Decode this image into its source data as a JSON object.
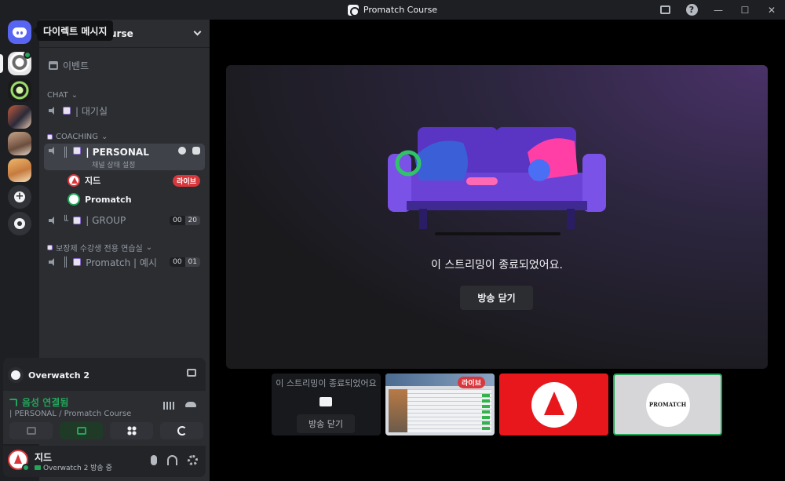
{
  "titlebar": {
    "title": "Promatch Course"
  },
  "tooltip": {
    "text": "다이렉트 메시지"
  },
  "guild": {
    "name_visible": "urse"
  },
  "sidebar": {
    "events_label": "이벤트",
    "chat_category": "CHAT",
    "waiting_room": "| 대기실",
    "coaching_category": "COACHING",
    "personal_channel": "| PERSONAL",
    "channel_status_hint": "채널 상태 설정",
    "members": [
      {
        "name": "지드",
        "badge": "라이브"
      },
      {
        "name": "Promatch"
      }
    ],
    "group_channel": "| GROUP",
    "group_counts": [
      "00",
      "20"
    ],
    "practice_category": "보장제 수강생 전용 연습실",
    "example_channel": "Promatch | 예시",
    "example_counts": [
      "00",
      "01"
    ]
  },
  "activity": {
    "game": "Overwatch 2"
  },
  "voice": {
    "status": "음성 연결됨",
    "location": "| PERSONAL / Promatch Course"
  },
  "user": {
    "name": "지드",
    "status": "Overwatch 2 방송 중"
  },
  "stage": {
    "ended_message": "이 스트리밍이 종료되었어요.",
    "close_button": "방송 닫기"
  },
  "tiles": {
    "ended_text": "이 스트리밍이 종료되었어요",
    "close_button": "방송 닫기",
    "live_badge": "라이브",
    "promatch_logo_text": "PROMATCH"
  },
  "colors": {
    "accent": "#5865f2",
    "online": "#23a55a",
    "live": "#da373c",
    "couch": "#6b42d6"
  }
}
